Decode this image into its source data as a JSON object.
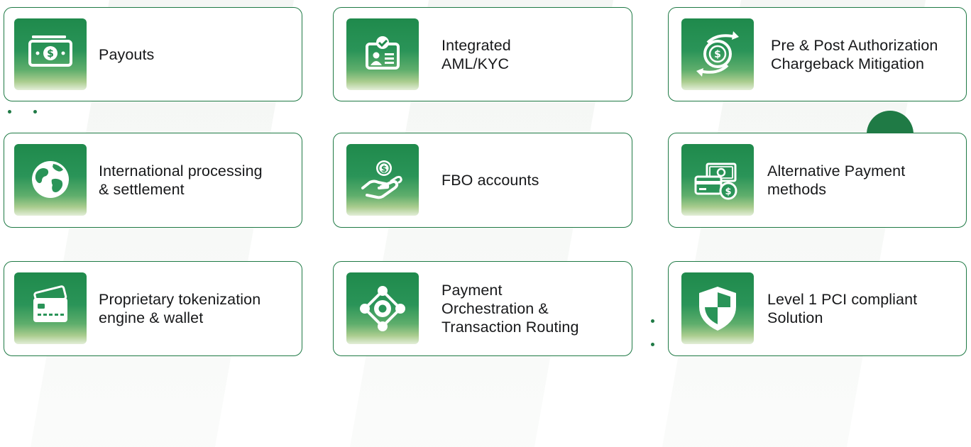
{
  "theme": {
    "accent": "#1f7a45",
    "tile_top": "#1f8a4c",
    "tile_bottom": "#e3eed8",
    "text": "#17181a"
  },
  "cards": [
    {
      "label": "Payouts",
      "icon": "cash-icon"
    },
    {
      "label": "Integrated\nAML/KYC",
      "icon": "id-card-check-icon"
    },
    {
      "label": "Pre & Post Authorization\nChargeback Mitigation",
      "icon": "dollar-cycle-icon"
    },
    {
      "label": "International processing\n& settlement",
      "icon": "globe-icon"
    },
    {
      "label": "FBO accounts",
      "icon": "coin-hand-icon"
    },
    {
      "label": "Alternative Payment\nmethods",
      "icon": "card-cash-icon"
    },
    {
      "label": "Proprietary tokenization\nengine & wallet",
      "icon": "credit-card-icon"
    },
    {
      "label": "Payment\nOrchestration &\nTransaction Routing",
      "icon": "network-nodes-icon"
    },
    {
      "label": "Level 1 PCI compliant\nSolution",
      "icon": "shield-icon"
    }
  ]
}
